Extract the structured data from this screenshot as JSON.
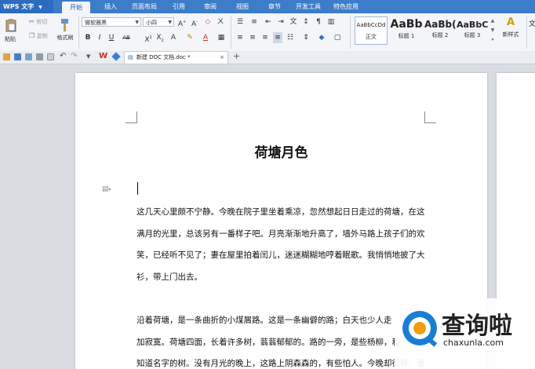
{
  "app": {
    "name": "WPS 文字"
  },
  "menu": {
    "tabs": [
      "开始",
      "插入",
      "页面布局",
      "引用",
      "审阅",
      "视图",
      "章节",
      "开发工具",
      "特色应用"
    ],
    "active_index": 0
  },
  "ribbon": {
    "paste_label": "粘贴",
    "cut_label": "剪切",
    "copy_label": "复制",
    "format_painter_label": "格式刷",
    "font_name": "微软雅黑",
    "font_size": "小四",
    "styles": [
      {
        "preview": "AaBbCcDd",
        "label": "正文"
      },
      {
        "preview": "AaBb",
        "label": "标题 1"
      },
      {
        "preview": "AaBb(",
        "label": "标题 2"
      },
      {
        "preview": "AaBbC",
        "label": "标题 3"
      }
    ],
    "new_style_label": "新样式"
  },
  "tabs_bar": {
    "doc_tab_label": "新建 DOC 文档.doc *"
  },
  "document": {
    "title": "荷塘月色",
    "paragraph1": [
      "这几天心里颇不宁静。今晚在院子里坐着乘凉，忽然想起日日走过的荷塘，在这",
      "满月的光里，总该另有一番样子吧。月亮渐渐地升高了，墙外马路上孩子们的欢",
      "笑，已经听不见了；妻在屋里拍着闰儿，迷迷糊糊地哼着眠歌。我悄悄地披了大",
      "衫，带上门出去。"
    ],
    "paragraph2": [
      "沿着荷塘，是一条曲折的小煤屑路。这是一条幽僻的路；白天也少人走",
      "加寂寞。荷塘四面，长着许多树，蓊蓊郁郁的。路的一旁，是些杨柳，和",
      "知道名字的树。没有月光的晚上，这路上阴森森的，有些怕人。今晚却很好，虽"
    ]
  },
  "watermark": {
    "name": "查询啦",
    "url": "chaxunla.com",
    "brand_color": "#1a7fd4",
    "accent_color": "#f39c12"
  }
}
